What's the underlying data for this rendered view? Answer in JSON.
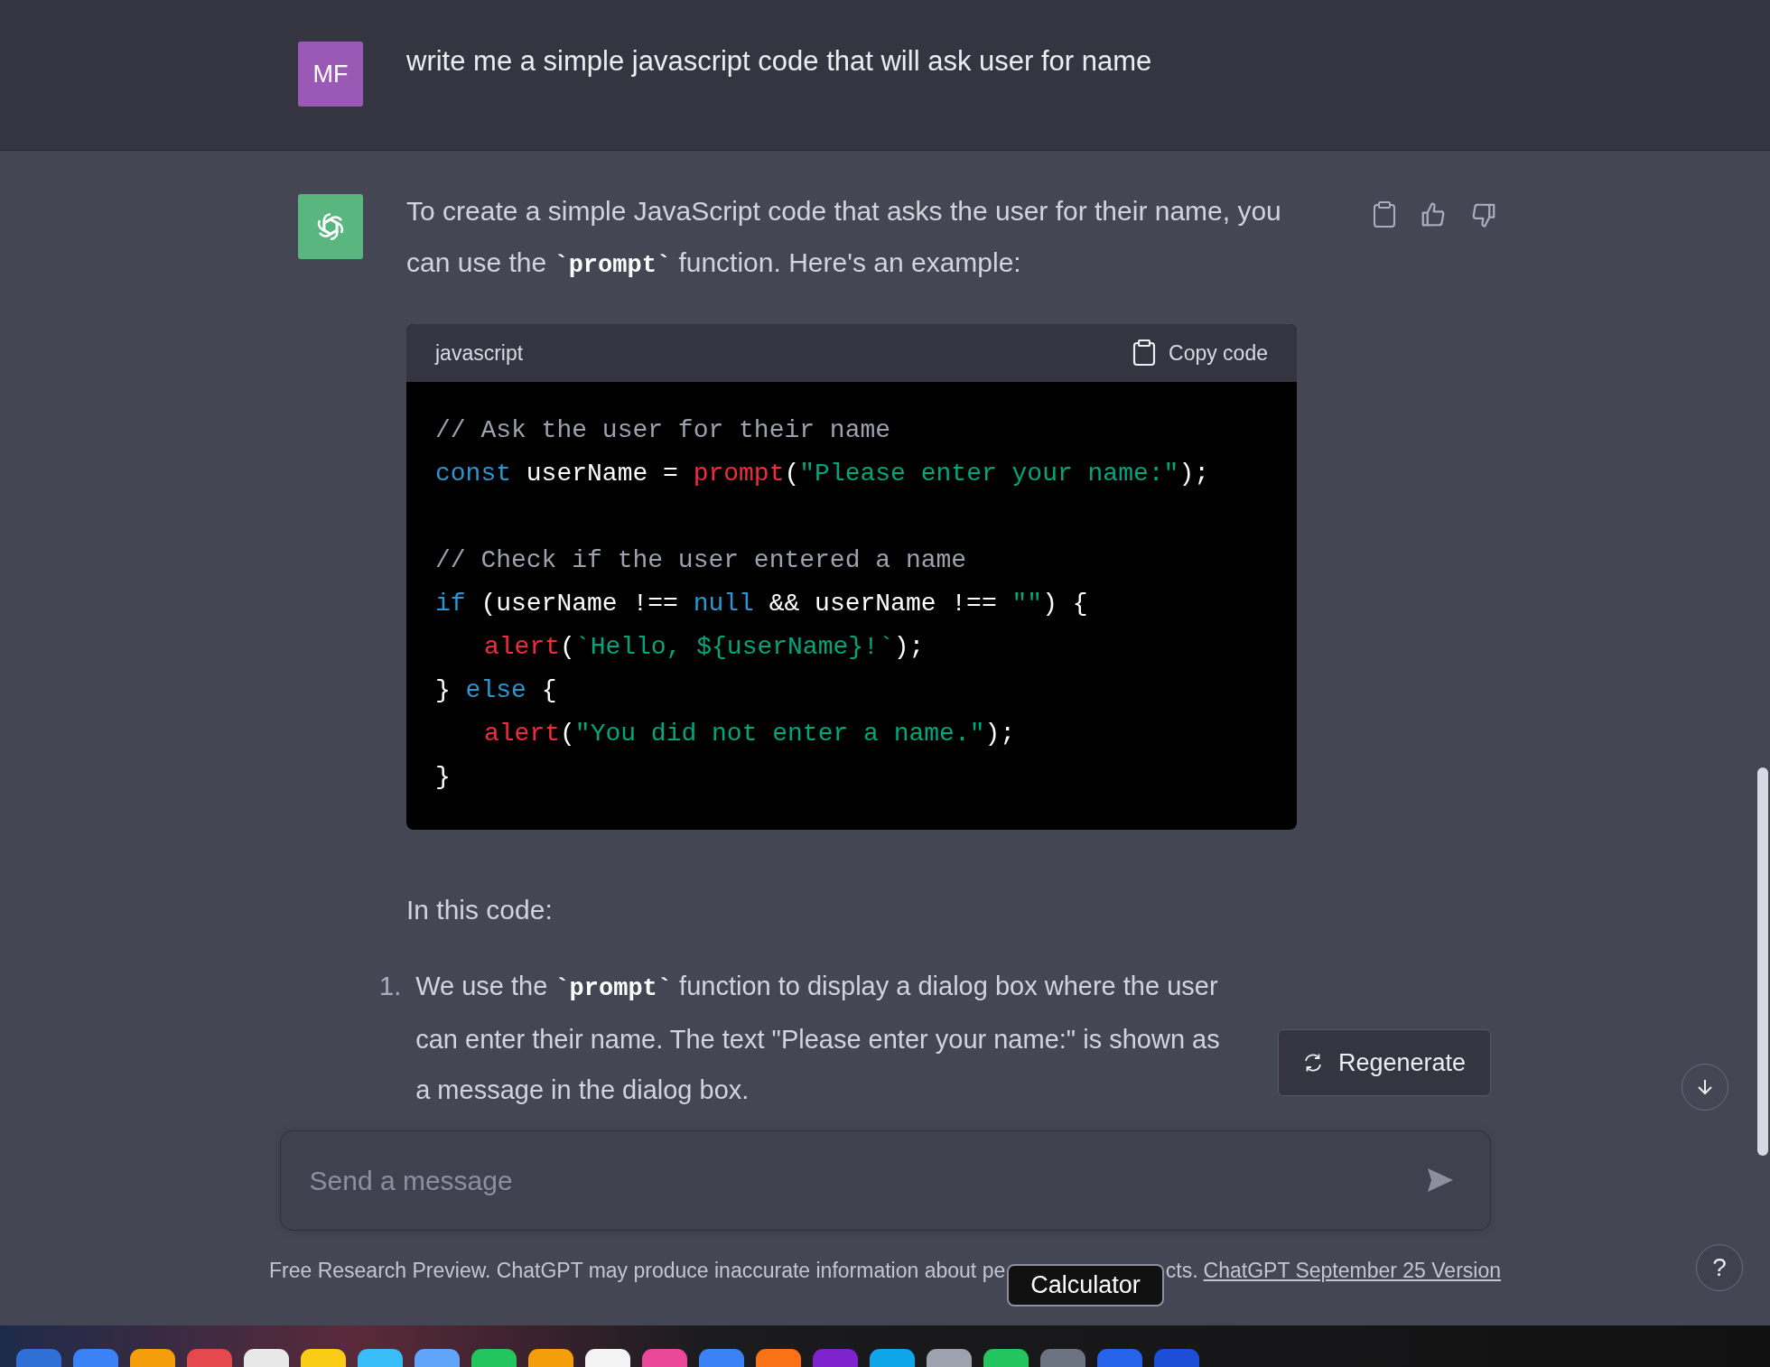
{
  "user_message": {
    "avatar": "MF",
    "text": "write me a simple javascript code that will ask user for name"
  },
  "assistant_message": {
    "intro": "To create a simple JavaScript code that asks the user for their name, you can use the **`prompt`** function. Here's an example:",
    "code_block": {
      "language": "javascript",
      "copy_label": "Copy code",
      "lines": [
        {
          "kind": "code",
          "tokens": [
            {
              "kind": "comment",
              "text": "// Ask the user for their name"
            }
          ]
        },
        {
          "kind": "code",
          "tokens": [
            {
              "kind": "keyword",
              "text": "const"
            },
            {
              "kind": "plain",
              "text": " userName = "
            },
            {
              "kind": "func",
              "text": "prompt"
            },
            {
              "kind": "plain",
              "text": "("
            },
            {
              "kind": "string",
              "text": "\"Please enter your name:\""
            },
            {
              "kind": "plain",
              "text": ");"
            }
          ]
        },
        {
          "kind": "blank"
        },
        {
          "kind": "code",
          "tokens": [
            {
              "kind": "comment",
              "text": "// Check if the user entered a name"
            }
          ]
        },
        {
          "kind": "code",
          "tokens": [
            {
              "kind": "keyword",
              "text": "if"
            },
            {
              "kind": "plain",
              "text": " (userName !== "
            },
            {
              "kind": "keyword",
              "text": "null"
            },
            {
              "kind": "plain",
              "text": " && userName !== "
            },
            {
              "kind": "string",
              "text": "\"\""
            },
            {
              "kind": "plain",
              "text": ") {"
            }
          ],
          "children": [
            {
              "kind": "code",
              "tokens": [
                {
                  "kind": "func",
                  "text": "alert"
                },
                {
                  "kind": "plain",
                  "text": "("
                },
                {
                  "kind": "string",
                  "text": "`Hello, ${userName}!`"
                },
                {
                  "kind": "plain",
                  "text": ");"
                }
              ]
            }
          ]
        },
        {
          "kind": "code",
          "tokens": [
            {
              "kind": "plain",
              "text": "} "
            },
            {
              "kind": "keyword",
              "text": "else"
            },
            {
              "kind": "plain",
              "text": " {"
            }
          ],
          "children": [
            {
              "kind": "code",
              "tokens": [
                {
                  "kind": "func",
                  "text": "alert"
                },
                {
                  "kind": "plain",
                  "text": "("
                },
                {
                  "kind": "string",
                  "text": "\"You did not enter a name.\""
                },
                {
                  "kind": "plain",
                  "text": ");"
                }
              ]
            }
          ]
        },
        {
          "kind": "code",
          "tokens": [
            {
              "kind": "plain",
              "text": "}"
            }
          ]
        }
      ]
    },
    "after_code": "In this code:",
    "list": [
      {
        "number": "1.",
        "text": "We use the **`prompt`** function to display a dialog box where the user can enter their name. The text \"Please enter your name:\" is shown as a message in the dialog box."
      }
    ]
  },
  "regenerate_label": "Regenerate",
  "composer": {
    "placeholder": "Send a message"
  },
  "footer": {
    "text_before": "Free Research Preview. ChatGPT may produce inaccurate information about pe",
    "text_after": "cts.",
    "link": "ChatGPT September 25 Version"
  },
  "tooltip": "Calculator",
  "help_label": "?"
}
